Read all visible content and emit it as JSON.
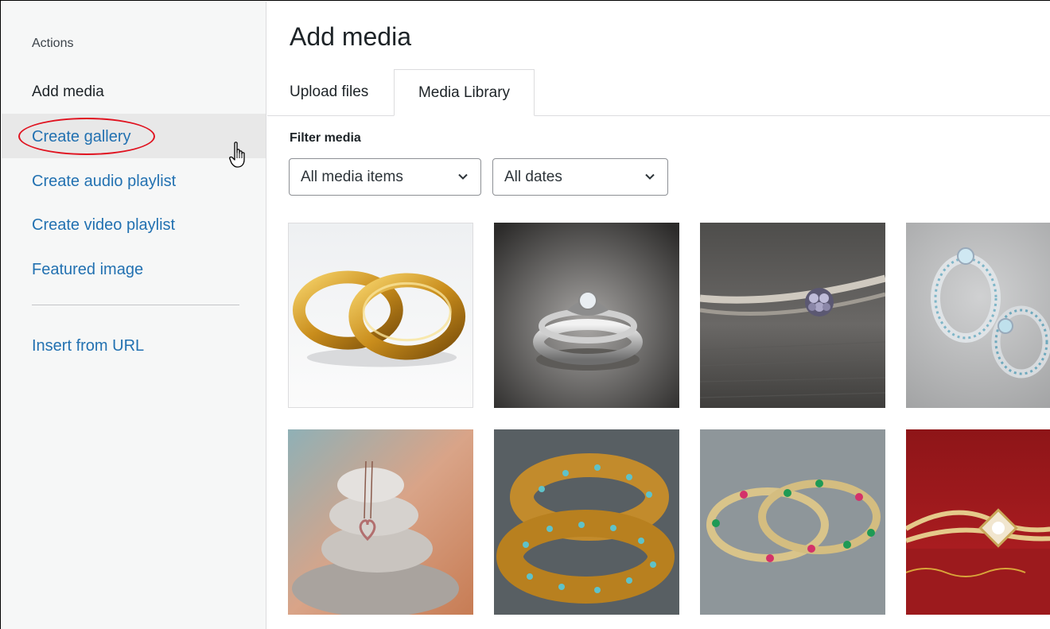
{
  "sidebar": {
    "heading": "Actions",
    "title": "Add media",
    "links": [
      {
        "label": "Create gallery"
      },
      {
        "label": "Create audio playlist"
      },
      {
        "label": "Create video playlist"
      },
      {
        "label": "Featured image"
      },
      {
        "label": "Insert from URL"
      }
    ]
  },
  "main": {
    "title": "Add media",
    "tabs": [
      {
        "label": "Upload files"
      },
      {
        "label": "Media Library"
      }
    ],
    "filter": {
      "label": "Filter media",
      "type_select": "All media items",
      "date_select": "All dates"
    }
  },
  "colors": {
    "link": "#2271b1",
    "highlight_ring": "#e0121f"
  },
  "icons": [
    "chevron-down-icon",
    "hand-pointer-icon"
  ]
}
